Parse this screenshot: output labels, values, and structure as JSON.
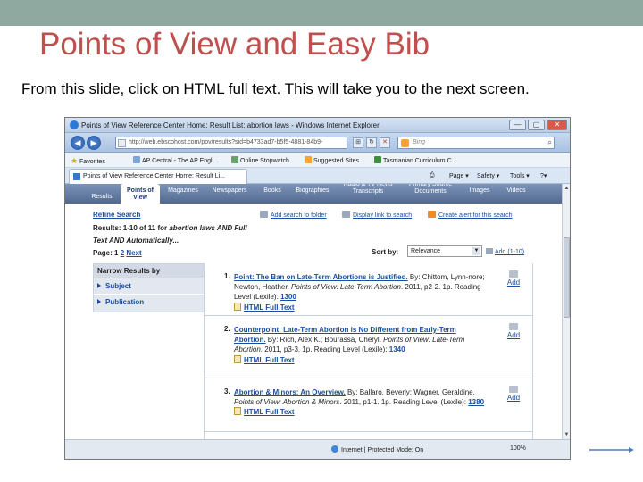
{
  "slide": {
    "title": "Points of View and Easy Bib",
    "subtitle": "From this slide, click on HTML  full text.  This will take you to the next screen."
  },
  "browser": {
    "window_title": "Points of View Reference Center Home: Result List: abortion laws - Windows Internet Explorer",
    "window_buttons": {
      "minimize": "—",
      "maximize": "▢",
      "close": "✕"
    },
    "address": "http://web.ebscohost.com/pov/results?sid=b4733ad7-b5f5-4881-84b9-",
    "search_placeholder": "Bing",
    "favorites": [
      {
        "label": "Favorites",
        "icon": "star-icon"
      },
      {
        "label": "AP Central - The AP Engli...",
        "icon": "page-icon"
      },
      {
        "label": "Online Stopwatch",
        "icon": "page-icon"
      },
      {
        "label": "Suggested Sites",
        "icon": "suggested-icon"
      },
      {
        "label": "Tasmanian Curriculum  C...",
        "icon": "page-icon"
      }
    ],
    "tab_title": "Points of View Reference Center Home: Result Li...",
    "commands": {
      "page": "Page ▾",
      "safety": "Safety ▾",
      "tools": "Tools ▾",
      "help": "?▾"
    },
    "status_zone": "Internet | Protected Mode: On",
    "zoom": "100%"
  },
  "ebsco": {
    "tabs": [
      {
        "label": "Results",
        "active": false
      },
      {
        "label": "Points of View",
        "active": true
      },
      {
        "label": "Magazines",
        "active": false
      },
      {
        "label": "Newspapers",
        "active": false
      },
      {
        "label": "Books",
        "active": false
      },
      {
        "label": "Biographies",
        "active": false
      },
      {
        "label": "Radio & TV News Transcripts",
        "active": false
      },
      {
        "label": "Primary Source Documents",
        "active": false
      },
      {
        "label": "Images",
        "active": false
      },
      {
        "label": "Videos",
        "active": false
      }
    ],
    "refine_label": "Refine Search",
    "results_prefix": "Results: 1-10 of 11 for ",
    "results_query": "abortion laws AND Full Text AND Automatically...",
    "page_label": "Page: 1 ",
    "page_link_2": "2",
    "page_next": "Next",
    "tools": {
      "add_search": "Add search to folder",
      "display_link": "Display link to search",
      "create_alert": "Create alert for this search"
    },
    "sort_label": "Sort by:",
    "sort_value": "Relevance",
    "add_all": "Add (1-10)",
    "narrow": {
      "heading": "Narrow Results by",
      "items": [
        "Subject",
        "Publication"
      ]
    },
    "results": [
      {
        "num": "1.",
        "title": "Point: The Ban on Late-Term Abortions is Justified.",
        "meta": " By: Chittom, Lynn-nore; Newton, Heather. ",
        "source": "Points of View: Late-Term Abortion",
        "details": ". 2011, p2-2. 1p. Reading Level (Lexile): ",
        "lexile": "1300",
        "fulltext": "HTML Full Text",
        "add": "Add"
      },
      {
        "num": "2.",
        "title": "Counterpoint: Late-Term Abortion is No Different from Early-Term Abortion.",
        "meta": " By: Rich, Alex K.; Bourassa, Cheryl. ",
        "source": "Points of View: Late-Term Abortion",
        "details": ". 2011, p3-3. 1p. Reading Level (Lexile): ",
        "lexile": "1340",
        "fulltext": "HTML Full Text",
        "add": "Add"
      },
      {
        "num": "3.",
        "title": "Abortion & Minors: An Overview.",
        "meta": " By: Ballaro, Beverly; Wagner, Geraldine. ",
        "source": "Points of View: Abortion & Minors",
        "details": ". 2011, p1-1. 1p. Reading Level (Lexile): ",
        "lexile": "1380",
        "fulltext": "HTML Full Text",
        "add": "Add"
      }
    ]
  }
}
